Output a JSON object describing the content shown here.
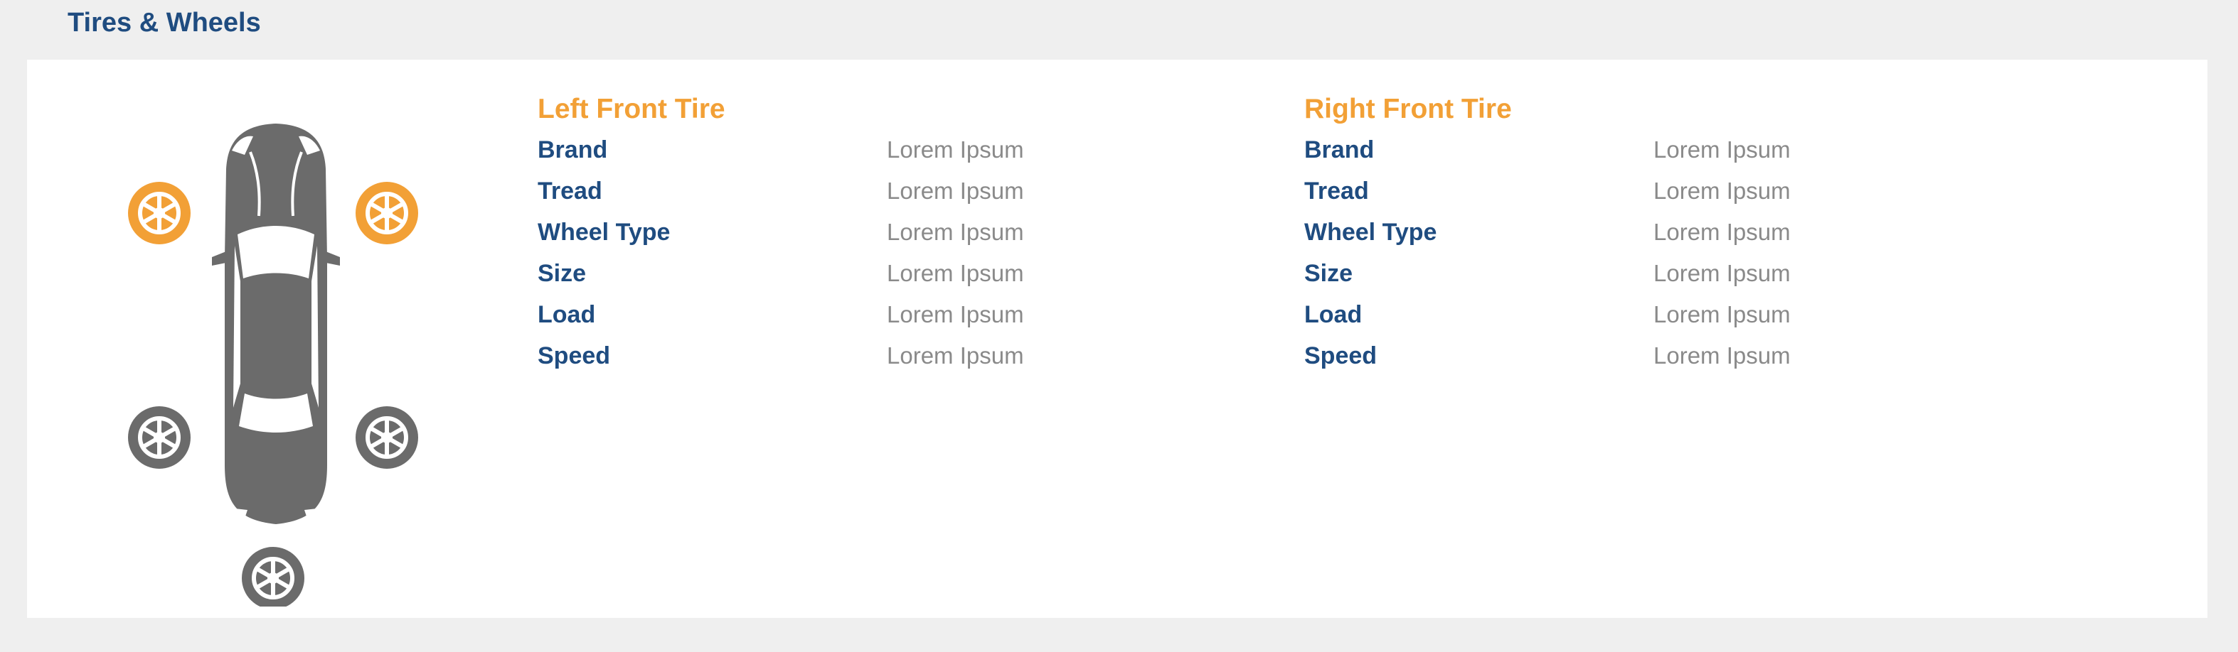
{
  "section": {
    "title": "Tires & Wheels"
  },
  "colors": {
    "accent": "#f2a036",
    "label": "#1f4c80",
    "value": "#8a8a8a",
    "car": "#6b6b6b",
    "background": "#efefef",
    "card": "#ffffff"
  },
  "car_diagram": {
    "icon": "car-top-view-icon",
    "selected_tires": [
      "front-left",
      "front-right"
    ],
    "tires": [
      "front-left",
      "front-right",
      "rear-left",
      "rear-right",
      "spare"
    ]
  },
  "left_tire": {
    "heading": "Left Front Tire",
    "specs": [
      {
        "label": "Brand",
        "value": "Lorem Ipsum"
      },
      {
        "label": "Tread",
        "value": "Lorem Ipsum"
      },
      {
        "label": "Wheel Type",
        "value": "Lorem Ipsum"
      },
      {
        "label": "Size",
        "value": "Lorem Ipsum"
      },
      {
        "label": "Load",
        "value": "Lorem Ipsum"
      },
      {
        "label": "Speed",
        "value": "Lorem Ipsum"
      }
    ]
  },
  "right_tire": {
    "heading": "Right Front Tire",
    "specs": [
      {
        "label": "Brand",
        "value": "Lorem Ipsum"
      },
      {
        "label": "Tread",
        "value": "Lorem Ipsum"
      },
      {
        "label": "Wheel Type",
        "value": "Lorem Ipsum"
      },
      {
        "label": "Size",
        "value": "Lorem Ipsum"
      },
      {
        "label": "Load",
        "value": "Lorem Ipsum"
      },
      {
        "label": "Speed",
        "value": "Lorem Ipsum"
      }
    ]
  }
}
